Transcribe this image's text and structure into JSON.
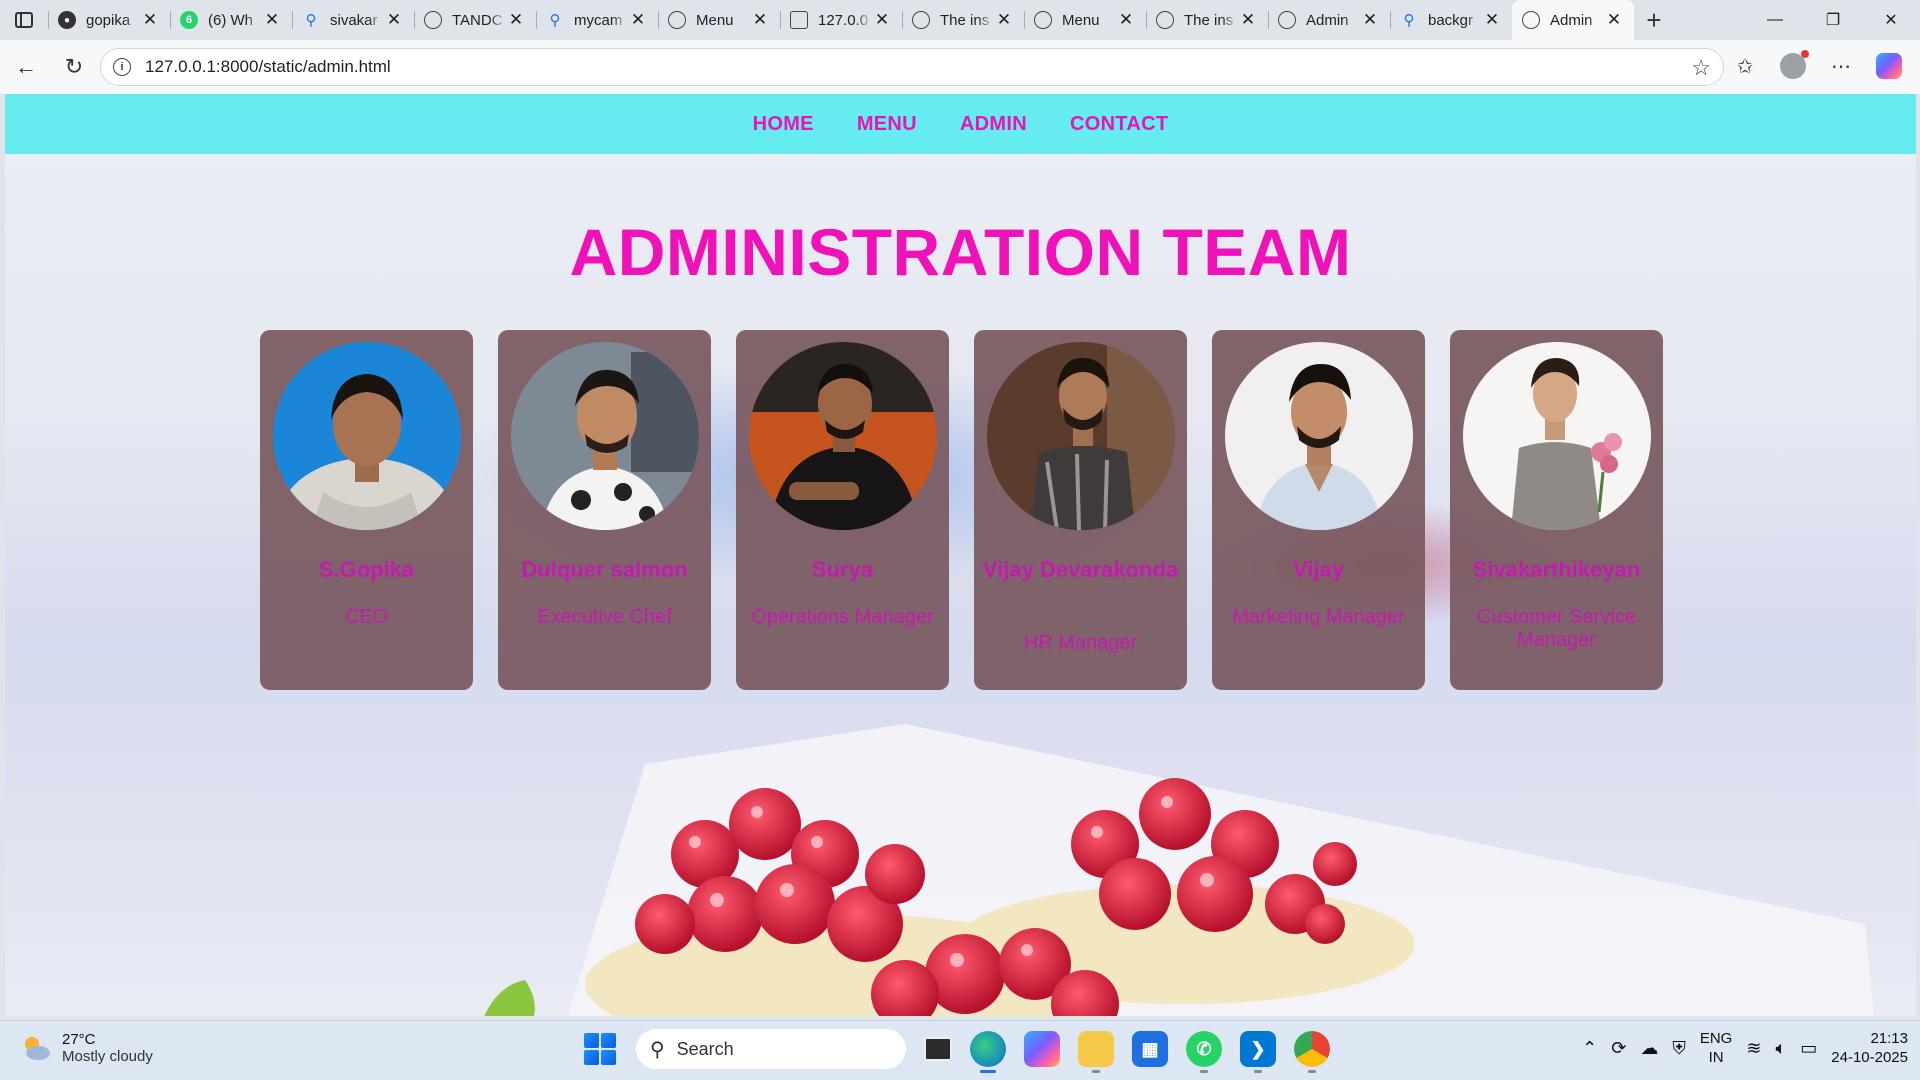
{
  "browser": {
    "tabs": [
      {
        "title": "gopika",
        "icon": "github-icon"
      },
      {
        "title": "(6) Wh",
        "icon": "whatsapp-icon",
        "badge": "6"
      },
      {
        "title": "sivakar",
        "icon": "search-icon"
      },
      {
        "title": "TANDC",
        "icon": "globe-icon"
      },
      {
        "title": "mycam",
        "icon": "search-icon"
      },
      {
        "title": "Menu",
        "icon": "globe-icon"
      },
      {
        "title": "127.0.0",
        "icon": "pdf-icon"
      },
      {
        "title": "The ins",
        "icon": "globe-icon"
      },
      {
        "title": "Menu",
        "icon": "globe-icon"
      },
      {
        "title": "The ins",
        "icon": "globe-icon"
      },
      {
        "title": "Admin",
        "icon": "globe-icon"
      },
      {
        "title": "backgr",
        "icon": "search-icon"
      },
      {
        "title": "Admin",
        "icon": "globe-icon",
        "active": true
      }
    ],
    "url": "127.0.0.1:8000/static/admin.html"
  },
  "page": {
    "nav": [
      "HOME",
      "MENU",
      "ADMIN",
      "CONTACT"
    ],
    "title": "ADMINISTRATION TEAM",
    "team": [
      {
        "name": "S.Gopika",
        "role": "CEO"
      },
      {
        "name": "Dulquer salmon",
        "role": "Executive Chef"
      },
      {
        "name": "Surya",
        "role": "Operations Manager"
      },
      {
        "name": "Vijay Devarakonda",
        "role": "HR Manager"
      },
      {
        "name": "Vijay",
        "role": "Marketing Manager"
      },
      {
        "name": "Sivakarthikeyan",
        "role": "Customer Service Manager"
      }
    ],
    "colors": {
      "navbar": "#65ecf0",
      "accent": "#ef12b8",
      "card": "#78585e"
    }
  },
  "taskbar": {
    "weather_temp": "27°C",
    "weather_desc": "Mostly cloudy",
    "search_placeholder": "Search",
    "lang_1": "ENG",
    "lang_2": "IN",
    "time": "21:13",
    "date": "24-10-2025"
  }
}
